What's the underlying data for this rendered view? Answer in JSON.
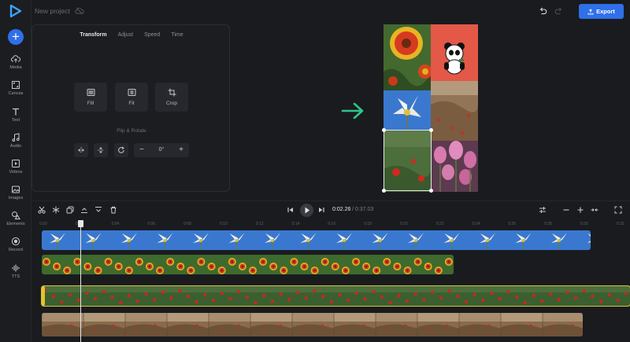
{
  "project": {
    "name": "New project"
  },
  "toolbar": {
    "export_label": "Export"
  },
  "sidebar": {
    "items": [
      {
        "label": "Media",
        "icon": "cloud-upload-icon"
      },
      {
        "label": "Canvas",
        "icon": "canvas-icon"
      },
      {
        "label": "Text",
        "icon": "text-icon"
      },
      {
        "label": "Audio",
        "icon": "music-note-icon"
      },
      {
        "label": "Videos",
        "icon": "video-icon"
      },
      {
        "label": "Images",
        "icon": "image-icon"
      },
      {
        "label": "Elements",
        "icon": "shapes-icon"
      },
      {
        "label": "Record",
        "icon": "record-icon"
      },
      {
        "label": "TTS",
        "icon": "waveform-icon"
      }
    ]
  },
  "panel": {
    "tabs": [
      "Transform",
      "Adjust",
      "Speed",
      "Time"
    ],
    "active_tab": "Transform",
    "tools": [
      "Fill",
      "Fit",
      "Crop"
    ],
    "flip_rotate_label": "Flip & Rotate",
    "rotation_value": "0°",
    "minus": "−",
    "plus": "+"
  },
  "playback": {
    "current_time": "0:02.26",
    "total_time": "/ 0:37.03"
  },
  "ruler": {
    "ticks": [
      "0:00",
      "0:02",
      "0:04",
      "0:06",
      "0:08",
      "0:10",
      "0:12",
      "0:14",
      "0:16",
      "0:18",
      "0:20",
      "0:22",
      "0:24",
      "0:26",
      "0:28",
      "0:30",
      "0:32"
    ]
  },
  "colors": {
    "accent": "#2f6fe8",
    "selection": "#d6c43c",
    "arrow": "#2ec68a",
    "background": "#1a1b1f"
  }
}
